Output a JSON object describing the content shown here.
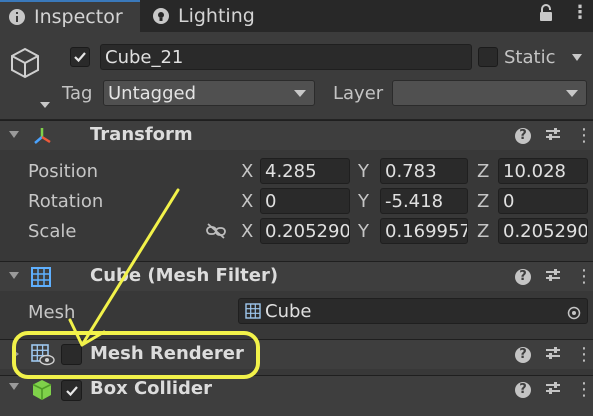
{
  "tabs": [
    {
      "label": "Inspector",
      "active": true,
      "icon": "info-icon"
    },
    {
      "label": "Lighting",
      "active": false,
      "icon": "lightbulb-icon"
    }
  ],
  "header": {
    "active": true,
    "object_name": "Cube_21",
    "static_label": "Static",
    "static_checked": false,
    "tag_label": "Tag",
    "tag_value": "Untagged",
    "layer_label": "Layer",
    "layer_value": ""
  },
  "transform": {
    "title": "Transform",
    "position": {
      "label": "Position",
      "x": "4.285",
      "y": "0.783",
      "z": "10.028"
    },
    "rotation": {
      "label": "Rotation",
      "x": "0",
      "y": "-5.418",
      "z": "0"
    },
    "scale": {
      "label": "Scale",
      "x": "0.205290",
      "y": "0.169957",
      "z": "0.205290"
    },
    "axis_x": "X",
    "axis_y": "Y",
    "axis_z": "Z"
  },
  "mesh_filter": {
    "title": "Cube (Mesh Filter)",
    "mesh_label": "Mesh",
    "mesh_value": "Cube"
  },
  "mesh_renderer": {
    "title": "Mesh Renderer",
    "enabled": false
  },
  "box_collider": {
    "title": "Box Collider",
    "enabled": true
  },
  "colors": {
    "panel": "#383838",
    "header": "#3e3e3e",
    "field": "#2a2a2a",
    "accent_tab": "#3a79bb",
    "annotation": "#f2f24a"
  }
}
